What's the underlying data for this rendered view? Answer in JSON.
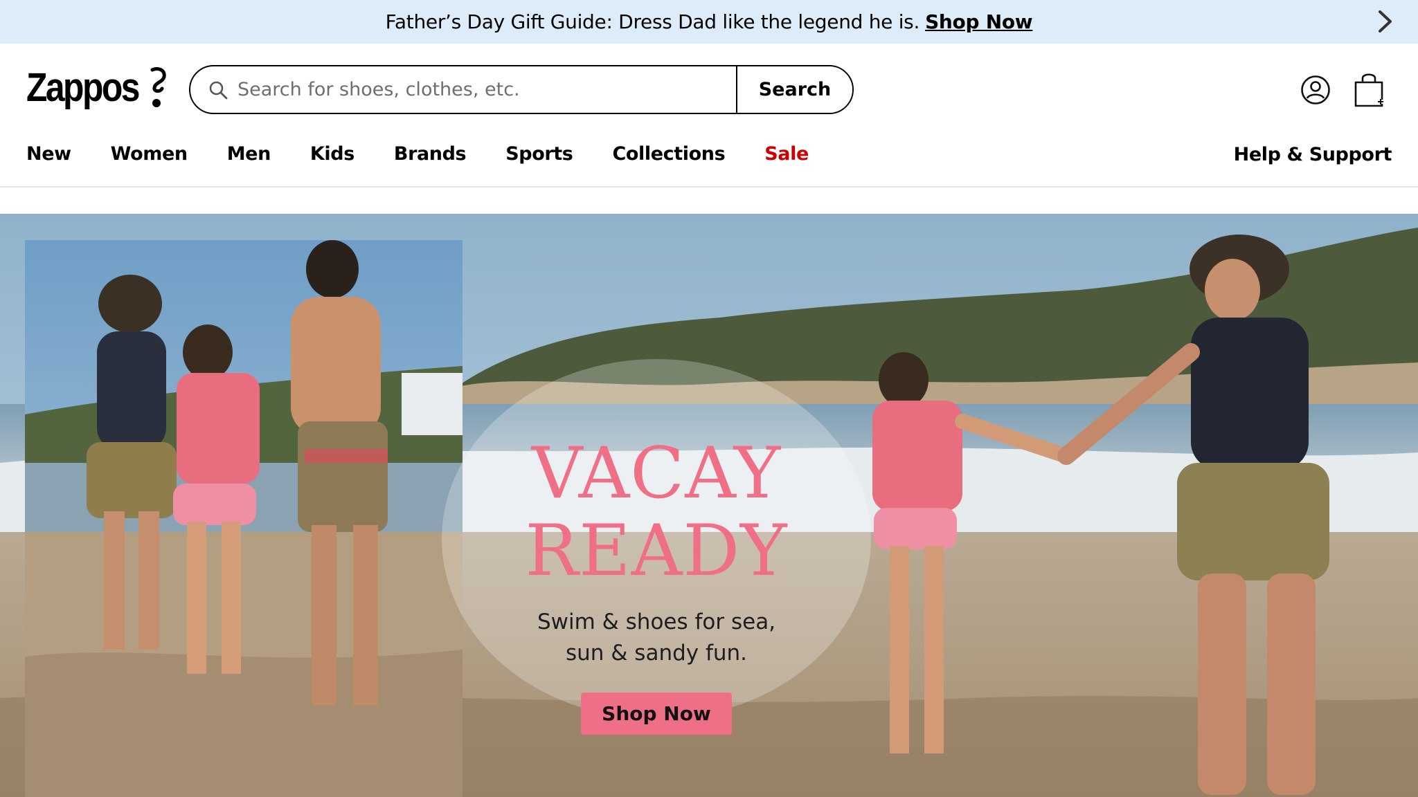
{
  "promo": {
    "text": "Father’s Day Gift Guide: Dress Dad like the legend he is.",
    "link_label": "Shop Now",
    "next_icon": "chevron-right-icon"
  },
  "header": {
    "logo_text": "Zappos",
    "search": {
      "placeholder": "Search for shoes, clothes, etc.",
      "value": "",
      "button_label": "Search",
      "icon": "search-icon"
    },
    "account_icon": "user-icon",
    "bag_icon": "shopping-bag-icon"
  },
  "nav": {
    "items": [
      {
        "label": "New"
      },
      {
        "label": "Women"
      },
      {
        "label": "Men"
      },
      {
        "label": "Kids"
      },
      {
        "label": "Brands"
      },
      {
        "label": "Sports"
      },
      {
        "label": "Collections"
      },
      {
        "label": "Sale"
      }
    ],
    "help_label": "Help & Support"
  },
  "hero": {
    "title_line1": "VACAY",
    "title_line2": "READY",
    "subtitle_line1": "Swim & shoes for sea,",
    "subtitle_line2": "sun & sandy fun.",
    "cta_label": "Shop Now"
  },
  "colors": {
    "promo_bg": "#dcedf9",
    "sale": "#cc0000",
    "hero_accent": "#ef6f87"
  }
}
